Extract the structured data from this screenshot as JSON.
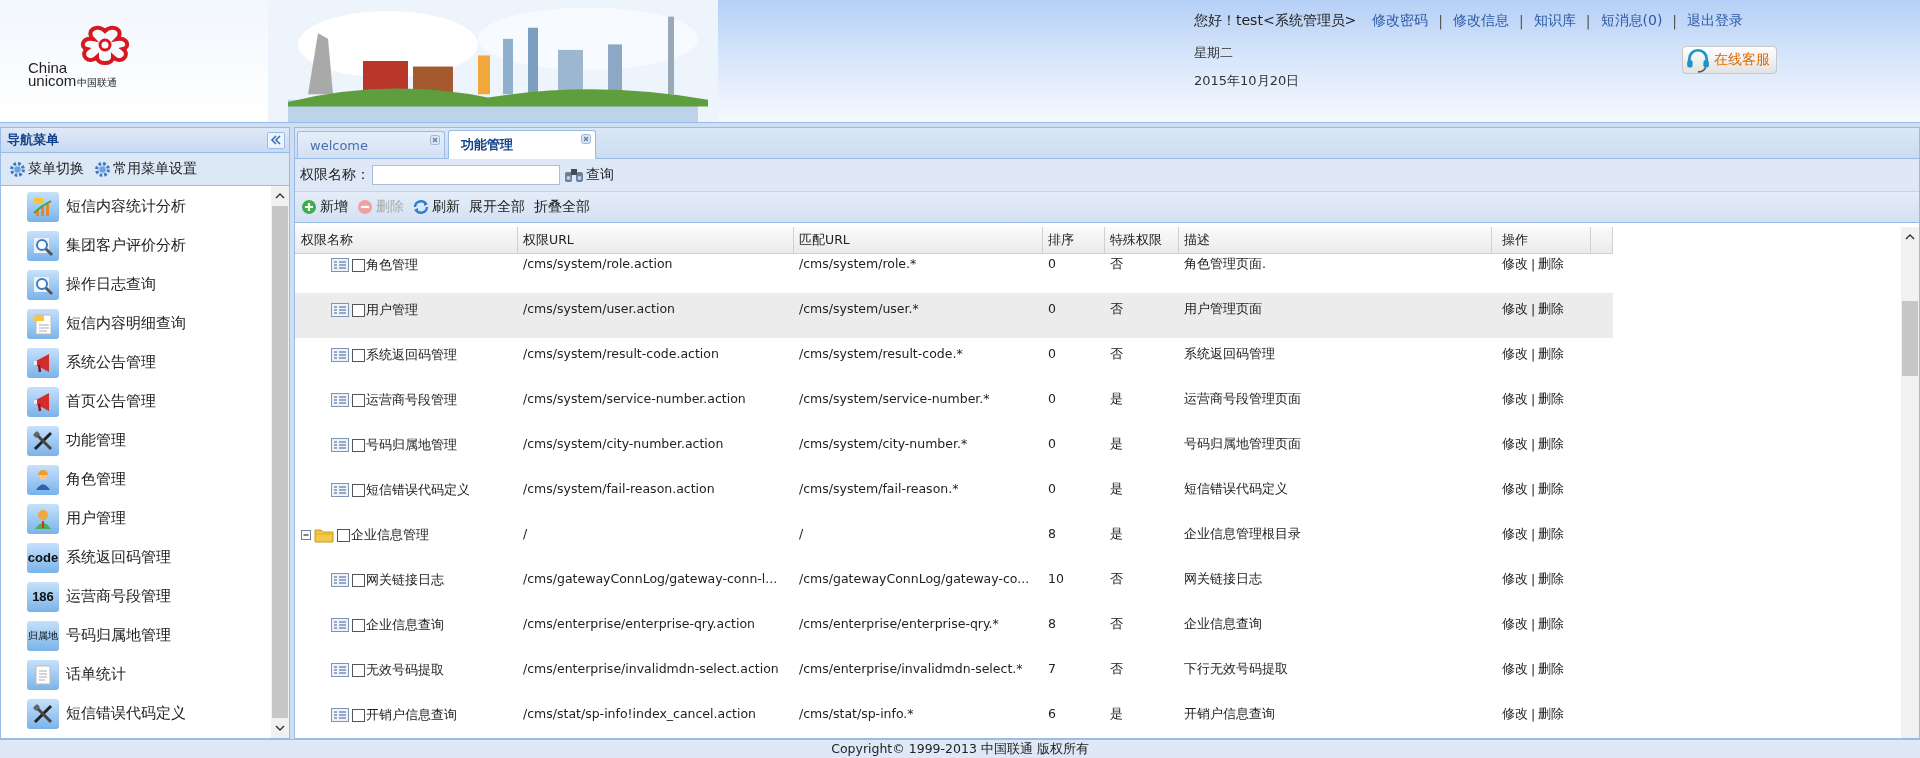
{
  "header": {
    "logo": {
      "line1": "China",
      "line2": "unicom",
      "line3": "中国联通"
    },
    "greeting": "您好！test<系统管理员>",
    "links": [
      {
        "kind": "link",
        "label": "修改密码"
      },
      {
        "kind": "sep",
        "label": "|"
      },
      {
        "kind": "link",
        "label": "修改信息"
      },
      {
        "kind": "sep",
        "label": "|"
      },
      {
        "kind": "link",
        "label": "知识库"
      },
      {
        "kind": "sep",
        "label": "|"
      },
      {
        "kind": "link",
        "label": "短消息(0)"
      },
      {
        "kind": "sep",
        "label": "|"
      },
      {
        "kind": "link",
        "label": "退出登录"
      }
    ],
    "weekday": "星期二",
    "date": "2015年10月20日",
    "service_button": "在线客服"
  },
  "sidebar": {
    "title": "导航菜单",
    "tools": [
      "菜单切换",
      "常用菜单设置"
    ],
    "items": [
      {
        "label": "短信内容统计分析",
        "kind": "chart"
      },
      {
        "label": "集团客户评价分析",
        "kind": "search"
      },
      {
        "label": "操作日志查询",
        "kind": "search"
      },
      {
        "label": "短信内容明细查询",
        "kind": "sms"
      },
      {
        "label": "系统公告管理",
        "kind": "megaphone"
      },
      {
        "label": "首页公告管理",
        "kind": "megaphone"
      },
      {
        "label": "功能管理",
        "kind": "tools"
      },
      {
        "label": "角色管理",
        "kind": "worker"
      },
      {
        "label": "用户管理",
        "kind": "user"
      },
      {
        "label": "系统返回码管理",
        "kind": "label",
        "icon_text": "code"
      },
      {
        "label": "运营商号段管理",
        "kind": "label",
        "icon_text": "186"
      },
      {
        "label": "号码归属地管理",
        "kind": "label",
        "icon_text": "归属地"
      },
      {
        "label": "话单统计",
        "kind": "document"
      },
      {
        "label": "短信错误代码定义",
        "kind": "tools"
      }
    ]
  },
  "tabs": [
    {
      "label": "welcome",
      "selected": false
    },
    {
      "label": "功能管理",
      "selected": true
    }
  ],
  "search": {
    "label": "权限名称：",
    "button": "查询"
  },
  "toolbar": [
    {
      "label": "新增",
      "kind": "add",
      "disabled": false
    },
    {
      "label": "删除",
      "kind": "remove",
      "disabled": true
    },
    {
      "label": "刷新",
      "kind": "refresh",
      "disabled": false
    },
    {
      "label": "展开全部",
      "kind": "plain",
      "disabled": false
    },
    {
      "label": "折叠全部",
      "kind": "plain",
      "disabled": false
    }
  ],
  "table": {
    "columns": [
      "权限名称",
      "权限URL",
      "匹配URL",
      "排序",
      "特殊权限",
      "描述",
      "操作"
    ],
    "continued_rows": [
      {
        "name": "角色管理",
        "url": "/cms/system/role.action",
        "match": "/cms/system/role.*",
        "order": "0",
        "special": "否",
        "desc": "角色管理页面.",
        "ops": [
          "修改",
          "|",
          "删除"
        ],
        "checked": false,
        "selected": false
      },
      {
        "name": "用户管理",
        "url": "/cms/system/user.action",
        "match": "/cms/system/user.*",
        "order": "0",
        "special": "否",
        "desc": "用户管理页面",
        "ops": [
          "修改",
          "|",
          "删除"
        ],
        "checked": false,
        "selected": true
      },
      {
        "name": "系统返回码管理",
        "url": "/cms/system/result-code.action",
        "match": "/cms/system/result-code.*",
        "order": "0",
        "special": "否",
        "desc": "系统返回码管理",
        "ops": [
          "修改",
          "|",
          "删除"
        ],
        "checked": false,
        "selected": false
      },
      {
        "name": "运营商号段管理",
        "url": "/cms/system/service-number.action",
        "match": "/cms/system/service-number.*",
        "order": "0",
        "special": "是",
        "desc": "运营商号段管理页面",
        "ops": [
          "修改",
          "|",
          "删除"
        ],
        "checked": false,
        "selected": false
      },
      {
        "name": "号码归属地管理",
        "url": "/cms/system/city-number.action",
        "match": "/cms/system/city-number.*",
        "order": "0",
        "special": "是",
        "desc": "号码归属地管理页面",
        "ops": [
          "修改",
          "|",
          "删除"
        ],
        "checked": false,
        "selected": false
      },
      {
        "name": "短信错误代码定义",
        "url": "/cms/system/fail-reason.action",
        "match": "/cms/system/fail-reason.*",
        "order": "0",
        "special": "是",
        "desc": "短信错误代码定义",
        "ops": [
          "修改",
          "|",
          "删除"
        ],
        "checked": false,
        "selected": false
      }
    ],
    "nodes": [
      {
        "name": "企业信息管理",
        "url": "/",
        "match": "/",
        "order": "8",
        "special": "是",
        "desc": "企业信息管理根目录",
        "ops": [
          "修改",
          "|",
          "删除"
        ],
        "checked": false,
        "selected": false,
        "expanded": true,
        "children": [
          {
            "name": "网关链接日志",
            "url": "/cms/gatewayConnLog/gateway-conn-l...",
            "match": "/cms/gatewayConnLog/gateway-co...",
            "order": "10",
            "special": "否",
            "desc": "网关链接日志",
            "ops": [
              "修改",
              "|",
              "删除"
            ],
            "checked": false,
            "selected": false
          },
          {
            "name": "企业信息查询",
            "url": "/cms/enterprise/enterprise-qry.action",
            "match": "/cms/enterprise/enterprise-qry.*",
            "order": "8",
            "special": "否",
            "desc": "企业信息查询",
            "ops": [
              "修改",
              "|",
              "删除"
            ],
            "checked": false,
            "selected": false
          },
          {
            "name": "无效号码提取",
            "url": "/cms/enterprise/invalidmdn-select.action",
            "match": "/cms/enterprise/invalidmdn-select.*",
            "order": "7",
            "special": "否",
            "desc": "下行无效号码提取",
            "ops": [
              "修改",
              "|",
              "删除"
            ],
            "checked": false,
            "selected": false
          },
          {
            "name": "开销户信息查询",
            "url": "/cms/stat/sp-info!index_cancel.action",
            "match": "/cms/stat/sp-info.*",
            "order": "6",
            "special": "是",
            "desc": "开销户信息查询",
            "ops": [
              "修改",
              "|",
              "删除"
            ],
            "checked": false,
            "selected": false
          }
        ]
      }
    ]
  },
  "footer": "Copyright© 1999-2013 中国联通  版权所有"
}
